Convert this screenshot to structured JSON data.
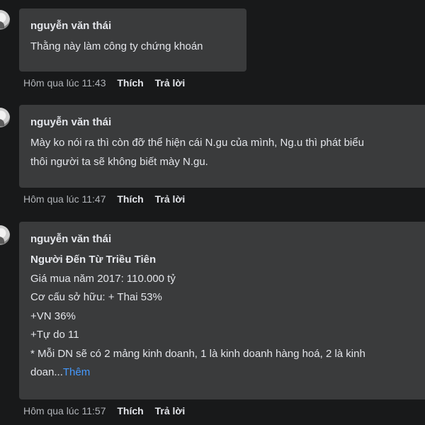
{
  "comments": [
    {
      "author": "nguyễn văn thái",
      "lines": [
        "Thằng này làm công ty chứng khoán"
      ],
      "timestamp": "Hôm qua lúc 11:43",
      "like_label": "Thích",
      "reply_label": "Trả lời"
    },
    {
      "author": "nguyễn văn thái",
      "lines": [
        "Mày ko nói ra thì còn đỡ thể hiện cái N.gu của mình, Ng.u thì phát biểu",
        "thôi người ta sẽ không biết mày N.gu."
      ],
      "timestamp": "Hôm qua lúc 11:47",
      "like_label": "Thích",
      "reply_label": "Trả lời"
    },
    {
      "author": "nguyễn văn thái",
      "headline": "Người Đến Từ Triều Tiên",
      "lines": [
        "Giá mua năm 2017: 110.000 tỷ",
        "Cơ cấu sở hữu: + Thai 53%",
        "+VN 36%",
        "+Tự do 11",
        "* Mỗi DN sẽ có 2 mảng kinh doanh, 1 là kinh doanh hàng hoá, 2 là kinh",
        "doan..."
      ],
      "more_label": "Thêm",
      "timestamp": "Hôm qua lúc 11:57",
      "like_label": "Thích",
      "reply_label": "Trả lời"
    }
  ],
  "colors": {
    "background": "#18191a",
    "bubble": "#3a3b3c",
    "text": "#e4e6eb",
    "meta": "#b0b3b8",
    "link": "#4599ff"
  }
}
